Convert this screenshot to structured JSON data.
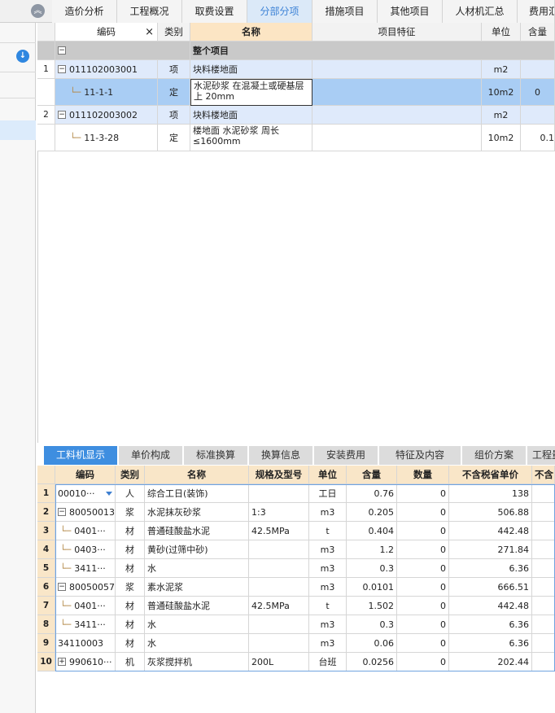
{
  "top_tabs": [
    {
      "label": "造价分析"
    },
    {
      "label": "工程概况"
    },
    {
      "label": "取费设置"
    },
    {
      "label": "分部分项"
    },
    {
      "label": "措施项目"
    },
    {
      "label": "其他项目"
    },
    {
      "label": "人材机汇总"
    },
    {
      "label": "费用汇"
    }
  ],
  "active_top_tab": "分部分项",
  "upper_table": {
    "headers": [
      "编码",
      "类别",
      "名称",
      "项目特征",
      "单位",
      "含量"
    ],
    "close_glyph": "×",
    "group_label": "整个项目",
    "rows": [
      {
        "num": "1",
        "code": "011102003001",
        "type": "项",
        "name": "块料楼地面",
        "feature": "",
        "unit": "m2",
        "qty": ""
      },
      {
        "num": "",
        "code": "11-1-1",
        "type": "定",
        "name": "水泥砂浆 在混凝土或硬基层上 20mm",
        "feature": "",
        "unit": "10m2",
        "qty": "0"
      },
      {
        "num": "2",
        "code": "011102003002",
        "type": "项",
        "name": "块料楼地面",
        "feature": "",
        "unit": "m2",
        "qty": ""
      },
      {
        "num": "",
        "code": "11-3-28",
        "type": "定",
        "name": "楼地面 水泥砂浆 周长≤1600mm",
        "feature": "",
        "unit": "10m2",
        "qty": "0.1"
      }
    ]
  },
  "bottom_tabs": [
    {
      "label": "工料机显示"
    },
    {
      "label": "单价构成"
    },
    {
      "label": "标准换算"
    },
    {
      "label": "换算信息"
    },
    {
      "label": "安装费用"
    },
    {
      "label": "特征及内容"
    },
    {
      "label": "组价方案"
    },
    {
      "label": "工程量"
    }
  ],
  "lower_table": {
    "headers": [
      "编码",
      "类别",
      "名称",
      "规格及型号",
      "单位",
      "含量",
      "数量",
      "不含税省单价",
      "不含"
    ],
    "rows": [
      {
        "num": "1",
        "code": "00010···",
        "type": "人",
        "name": "综合工日(装饰)",
        "spec": "",
        "unit": "工日",
        "content": "0.76",
        "amount": "0",
        "price": "138"
      },
      {
        "num": "2",
        "code": "80050013",
        "type": "浆",
        "name": "水泥抹灰砂浆",
        "spec": "1:3",
        "unit": "m3",
        "content": "0.205",
        "amount": "0",
        "price": "506.88"
      },
      {
        "num": "3",
        "code": "0401···",
        "type": "材",
        "name": "普通硅酸盐水泥",
        "spec": "42.5MPa",
        "unit": "t",
        "content": "0.404",
        "amount": "0",
        "price": "442.48"
      },
      {
        "num": "4",
        "code": "0403···",
        "type": "材",
        "name": "黄砂(过筛中砂)",
        "spec": "",
        "unit": "m3",
        "content": "1.2",
        "amount": "0",
        "price": "271.84"
      },
      {
        "num": "5",
        "code": "3411···",
        "type": "材",
        "name": "水",
        "spec": "",
        "unit": "m3",
        "content": "0.3",
        "amount": "0",
        "price": "6.36"
      },
      {
        "num": "6",
        "code": "80050057",
        "type": "浆",
        "name": "素水泥浆",
        "spec": "",
        "unit": "m3",
        "content": "0.0101",
        "amount": "0",
        "price": "666.51"
      },
      {
        "num": "7",
        "code": "0401···",
        "type": "材",
        "name": "普通硅酸盐水泥",
        "spec": "42.5MPa",
        "unit": "t",
        "content": "1.502",
        "amount": "0",
        "price": "442.48"
      },
      {
        "num": "8",
        "code": "3411···",
        "type": "材",
        "name": "水",
        "spec": "",
        "unit": "m3",
        "content": "0.3",
        "amount": "0",
        "price": "6.36"
      },
      {
        "num": "9",
        "code": "34110003",
        "type": "材",
        "name": "水",
        "spec": "",
        "unit": "m3",
        "content": "0.06",
        "amount": "0",
        "price": "6.36"
      },
      {
        "num": "10",
        "code": "990610···",
        "type": "机",
        "name": "灰浆搅拌机",
        "spec": "200L",
        "unit": "台班",
        "content": "0.0256",
        "amount": "0",
        "price": "202.44"
      }
    ]
  },
  "icons": {
    "collapse": "double-chevron-up-icon",
    "download": "download-arrow-icon",
    "dropdown": "dropdown-triangle-icon"
  },
  "colors": {
    "accent_blue": "#3e8ee0",
    "selected_row": "#a9cdf4",
    "item_row": "#dfeafb",
    "header_orange": "#f9e6c8",
    "name_header": "#fce5c4"
  }
}
